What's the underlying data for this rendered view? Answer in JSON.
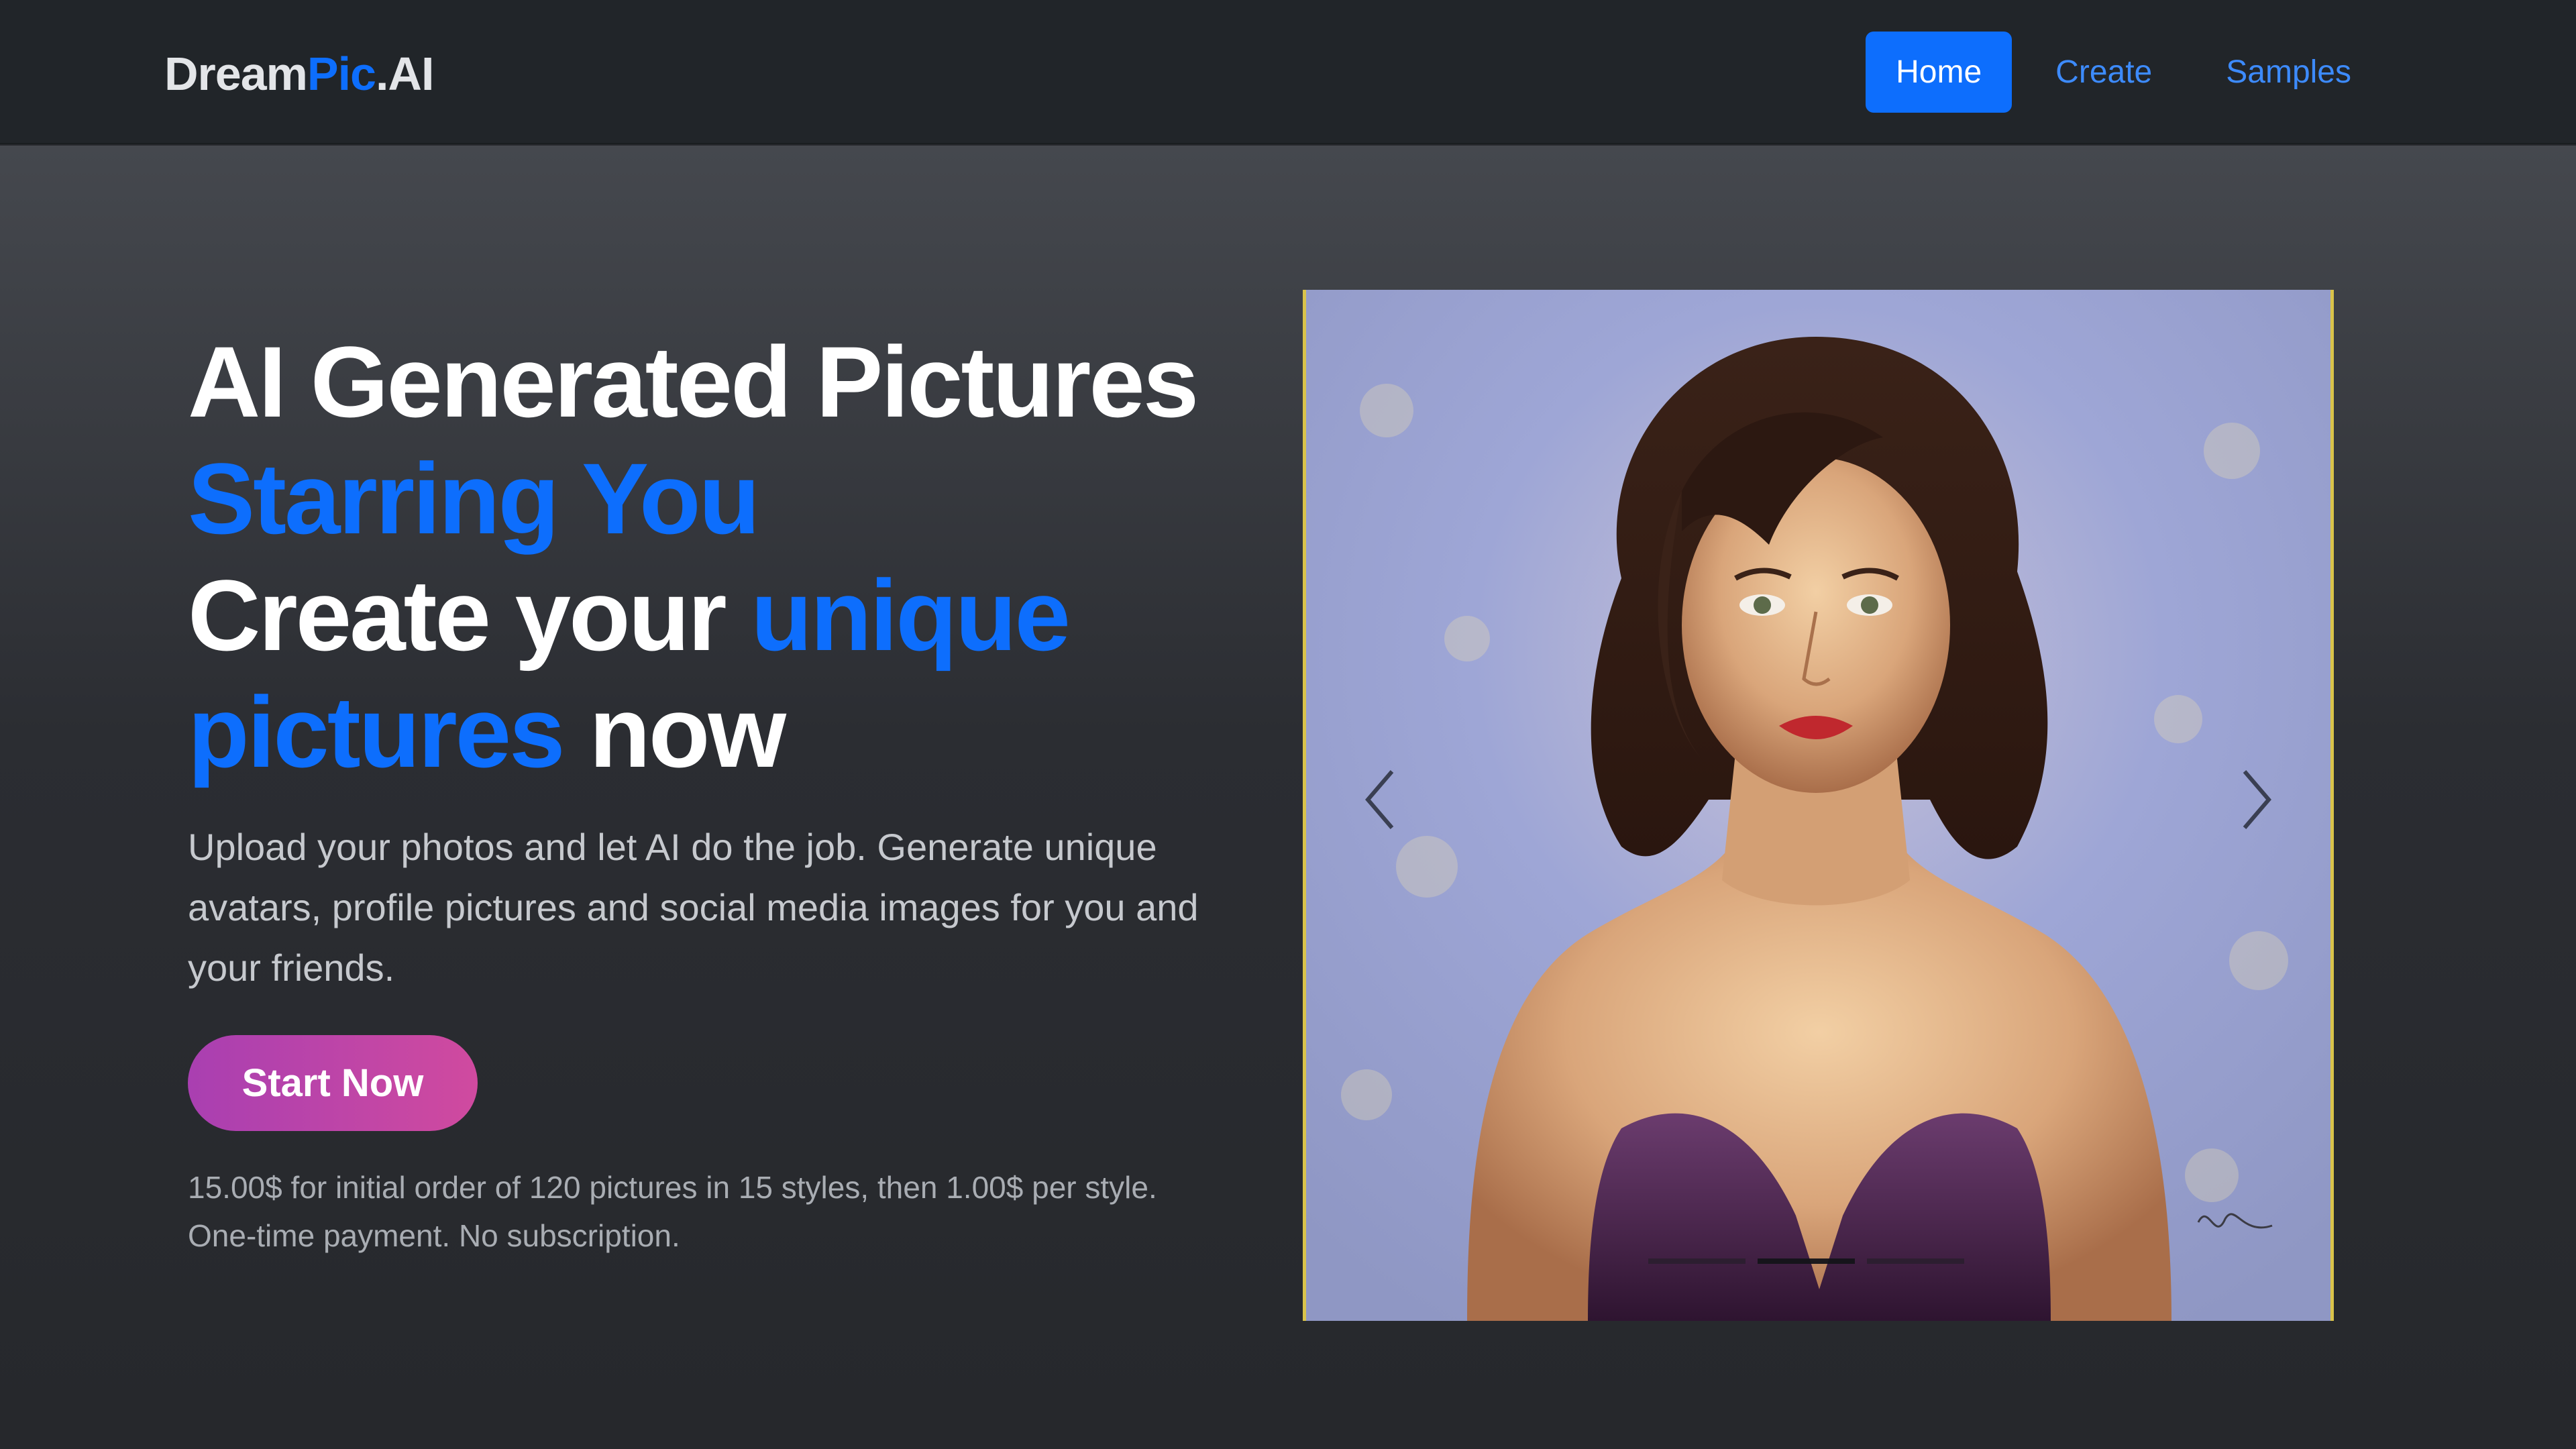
{
  "brand": {
    "part1": "Dream",
    "part2": "Pic",
    "part3": ".AI"
  },
  "nav": {
    "home": "Home",
    "create": "Create",
    "samples": "Samples"
  },
  "hero": {
    "line1": "AI Generated Pictures",
    "line2": "Starring You",
    "line3_a": "Create your ",
    "line3_b": "unique",
    "line4_a": "pictures",
    "line4_b": " now",
    "lead": "Upload your photos and let AI do the job. Generate unique avatars, profile pictures and social media images for you and your friends.",
    "cta": "Start Now",
    "price_line1": "15.00$ for initial order of 120 pictures in 15 styles, then 1.00$ per style.",
    "price_line2": "One-time payment. No subscription."
  },
  "carousel": {
    "slides": 3,
    "active_slide": 2,
    "prev_icon": "chevron-left-icon",
    "next_icon": "chevron-right-icon"
  },
  "colors": {
    "accent": "#0d6efd",
    "navbar_bg": "#212529",
    "cta_gradient_start": "#a93fb1",
    "cta_gradient_end": "#d04a9f",
    "frame": "#d9c34a"
  }
}
